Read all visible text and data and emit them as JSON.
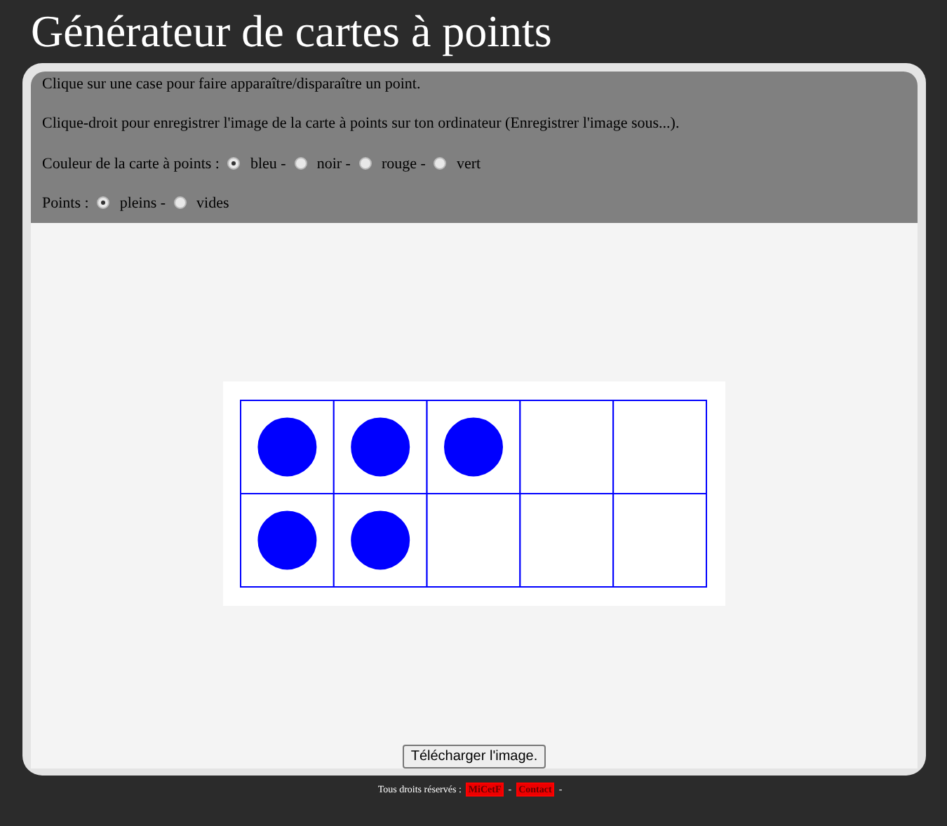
{
  "title": "Générateur de cartes à points",
  "instructions": [
    "Clique sur une case pour faire apparaître/disparaître un point.",
    "Clique-droit pour enregistrer l'image de la carte à points sur ton ordinateur (Enregistrer l'image sous...)."
  ],
  "color_option": {
    "label": "Couleur de la carte à points :",
    "options": [
      {
        "label": "bleu -",
        "selected": true
      },
      {
        "label": "noir -",
        "selected": false
      },
      {
        "label": "rouge -",
        "selected": false
      },
      {
        "label": "vert",
        "selected": false
      }
    ]
  },
  "dots_option": {
    "label": "Points :",
    "options": [
      {
        "label": "pleins -",
        "selected": true
      },
      {
        "label": "vides",
        "selected": false
      }
    ]
  },
  "card": {
    "color": "#0000ff",
    "rows": [
      [
        {
          "filled": true
        },
        {
          "filled": true
        },
        {
          "filled": true
        },
        {
          "filled": false
        },
        {
          "filled": false
        }
      ],
      [
        {
          "filled": true
        },
        {
          "filled": true
        },
        {
          "filled": false
        },
        {
          "filled": false
        },
        {
          "filled": false
        }
      ]
    ]
  },
  "download_button": "Télécharger l'image.",
  "footer": {
    "text": "Tous droits réservés :",
    "links": [
      "MiCetF",
      "Contact"
    ],
    "separators": [
      "-",
      "-"
    ]
  }
}
